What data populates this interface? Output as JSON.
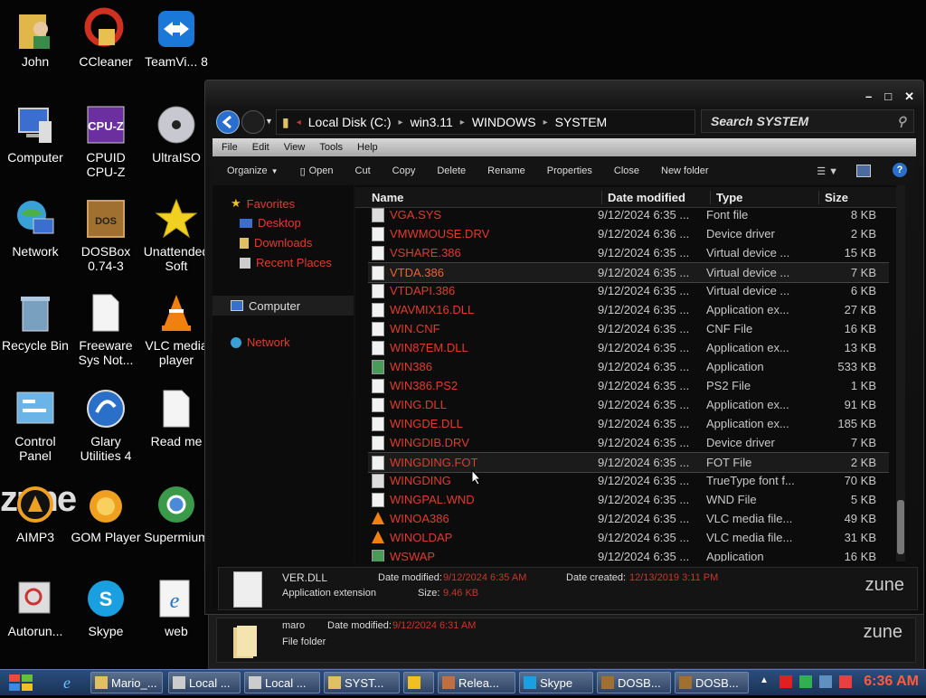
{
  "desktop": {
    "icons": [
      {
        "label": "John"
      },
      {
        "label": "CCleaner"
      },
      {
        "label": "TeamVi... 8"
      },
      {
        "label": "Computer"
      },
      {
        "label": "CPUID CPU-Z"
      },
      {
        "label": "UltraISO"
      },
      {
        "label": "Network"
      },
      {
        "label": "DOSBox 0.74-3"
      },
      {
        "label": "Unattended Soft"
      },
      {
        "label": "Recycle Bin"
      },
      {
        "label": "Freeware Sys Not..."
      },
      {
        "label": "VLC media player"
      },
      {
        "label": "Control Panel"
      },
      {
        "label": "Glary Utilities 4"
      },
      {
        "label": "Read me"
      },
      {
        "label": "AIMP3"
      },
      {
        "label": "GOM Player"
      },
      {
        "label": "Supermium"
      },
      {
        "label": "Autorun..."
      },
      {
        "label": "Skype"
      },
      {
        "label": "web"
      }
    ],
    "zune_text": "zune"
  },
  "explorer": {
    "caption_buttons": {
      "minimize": "–",
      "maximize": "□",
      "close": "✕"
    },
    "breadcrumb": [
      "Local Disk (C:)",
      "win3.11",
      "WINDOWS",
      "SYSTEM"
    ],
    "search_placeholder": "Search SYSTEM",
    "menu": [
      "File",
      "Edit",
      "View",
      "Tools",
      "Help"
    ],
    "toolbar": [
      "Organize",
      "Open",
      "Cut",
      "Copy",
      "Delete",
      "Rename",
      "Properties",
      "Close",
      "New folder"
    ],
    "nav": {
      "favorites": "Favorites",
      "desktop": "Desktop",
      "downloads": "Downloads",
      "recent": "Recent Places",
      "computer": "Computer",
      "network": "Network"
    },
    "columns": {
      "name": "Name",
      "date": "Date modified",
      "type": "Type",
      "size": "Size"
    },
    "files": [
      {
        "name": "VGA.SYS",
        "date": "9/12/2024 6:35 ...",
        "type": "Font file",
        "size": "8 KB",
        "icon": "font-file-icon"
      },
      {
        "name": "VMWMOUSE.DRV",
        "date": "9/12/2024 6:36 ...",
        "type": "Device driver",
        "size": "2 KB",
        "icon": "file-icon"
      },
      {
        "name": "VSHARE.386",
        "date": "9/12/2024 6:35 ...",
        "type": "Virtual device ...",
        "size": "15 KB",
        "icon": "file-icon"
      },
      {
        "name": "VTDA.386",
        "date": "9/12/2024 6:35 ...",
        "type": "Virtual device ...",
        "size": "7 KB",
        "icon": "file-icon"
      },
      {
        "name": "VTDAPI.386",
        "date": "9/12/2024 6:35 ...",
        "type": "Virtual device ...",
        "size": "6 KB",
        "icon": "file-icon"
      },
      {
        "name": "WAVMIX16.DLL",
        "date": "9/12/2024 6:35 ...",
        "type": "Application ex...",
        "size": "27 KB",
        "icon": "file-icon"
      },
      {
        "name": "WIN.CNF",
        "date": "9/12/2024 6:35 ...",
        "type": "CNF File",
        "size": "16 KB",
        "icon": "file-icon"
      },
      {
        "name": "WIN87EM.DLL",
        "date": "9/12/2024 6:35 ...",
        "type": "Application ex...",
        "size": "13 KB",
        "icon": "file-icon"
      },
      {
        "name": "WIN386",
        "date": "9/12/2024 6:35 ...",
        "type": "Application",
        "size": "533 KB",
        "icon": "app-icon"
      },
      {
        "name": "WIN386.PS2",
        "date": "9/12/2024 6:35 ...",
        "type": "PS2 File",
        "size": "1 KB",
        "icon": "file-icon"
      },
      {
        "name": "WING.DLL",
        "date": "9/12/2024 6:35 ...",
        "type": "Application ex...",
        "size": "91 KB",
        "icon": "file-icon"
      },
      {
        "name": "WINGDE.DLL",
        "date": "9/12/2024 6:35 ...",
        "type": "Application ex...",
        "size": "185 KB",
        "icon": "file-icon"
      },
      {
        "name": "WINGDIB.DRV",
        "date": "9/12/2024 6:35 ...",
        "type": "Device driver",
        "size": "7 KB",
        "icon": "file-icon"
      },
      {
        "name": "WINGDING.FOT",
        "date": "9/12/2024 6:35 ...",
        "type": "FOT File",
        "size": "2 KB",
        "icon": "file-icon"
      },
      {
        "name": "WINGDING",
        "date": "9/12/2024 6:35 ...",
        "type": "TrueType font f...",
        "size": "70 KB",
        "icon": "font-file-icon"
      },
      {
        "name": "WINGPAL.WND",
        "date": "9/12/2024 6:35 ...",
        "type": "WND File",
        "size": "5 KB",
        "icon": "file-icon"
      },
      {
        "name": "WINOA386",
        "date": "9/12/2024 6:35 ...",
        "type": "VLC media file...",
        "size": "49 KB",
        "icon": "vlc-icon"
      },
      {
        "name": "WINOLDAP",
        "date": "9/12/2024 6:35 ...",
        "type": "VLC media file...",
        "size": "31 KB",
        "icon": "vlc-icon"
      },
      {
        "name": "WSWAP",
        "date": "9/12/2024 6:35 ...",
        "type": "Application",
        "size": "16 KB",
        "icon": "app-icon"
      }
    ],
    "details": {
      "filename": "VER.DLL",
      "type": "Application extension",
      "date_modified_label": "Date modified:",
      "date_modified": "9/12/2024 6:35 AM",
      "date_created_label": "Date created:",
      "date_created": "12/13/2019 3:11 PM",
      "size_label": "Size:",
      "size": "9.46 KB",
      "zune": "zune"
    }
  },
  "back_window": {
    "name": "maro",
    "type": "File folder",
    "date_modified_label": "Date modified:",
    "date_modified": "9/12/2024 6:31 AM",
    "zune": "zune"
  },
  "taskbar": {
    "items": [
      {
        "label": "Mario_..."
      },
      {
        "label": "Local ..."
      },
      {
        "label": "Local ..."
      },
      {
        "label": "SYST..."
      },
      {
        "label": ""
      },
      {
        "label": "Relea..."
      },
      {
        "label": "Skype"
      },
      {
        "label": "DOSB..."
      },
      {
        "label": "DOSB..."
      }
    ],
    "clock": "6:36 AM"
  },
  "colors": {
    "accent_red": "#e23b2b",
    "taskbar_blue": "#1a3356",
    "clock": "#ff5a3a"
  }
}
